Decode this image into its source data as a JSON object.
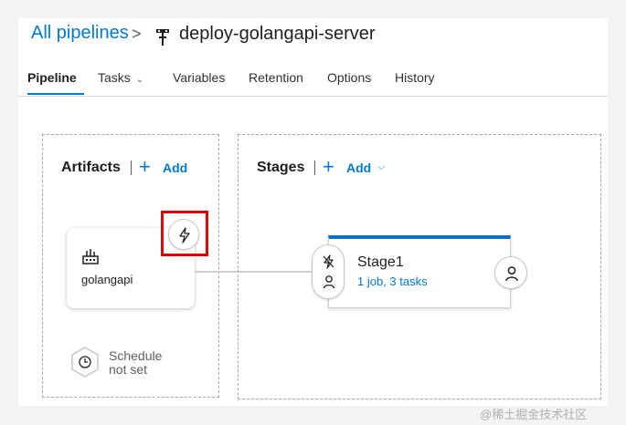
{
  "breadcrumb": {
    "all_pipelines": "All pipelines",
    "separator": ">",
    "pipeline_icon": "pipeline-icon",
    "pipeline_name": "deploy-golangapi-server"
  },
  "tabs": [
    {
      "label": "Pipeline",
      "active": true
    },
    {
      "label": "Tasks",
      "has_dropdown": true
    },
    {
      "label": "Variables"
    },
    {
      "label": "Retention"
    },
    {
      "label": "Options"
    },
    {
      "label": "History"
    }
  ],
  "artifacts": {
    "title": "Artifacts",
    "add_label": "Add",
    "add_icon": "plus-icon",
    "card": {
      "name": "golangapi",
      "icon": "build-artifact-icon",
      "trigger_icon": "lightning-icon"
    },
    "schedule": {
      "icon": "clock-icon",
      "line1": "Schedule",
      "line2": "not set"
    }
  },
  "stages": {
    "title": "Stages",
    "add_label": "Add",
    "add_icon": "plus-icon",
    "stage": {
      "name": "Stage1",
      "summary": "1 job, 3 tasks",
      "predeploy_icons": [
        "lightning-icon",
        "person-icon"
      ],
      "postdeploy_icon": "person-icon"
    }
  },
  "colors": {
    "accent": "#0078d4",
    "stage_bar": "#106ebe",
    "highlight": "#e00000"
  },
  "watermark": "@稀土掘金技术社区"
}
